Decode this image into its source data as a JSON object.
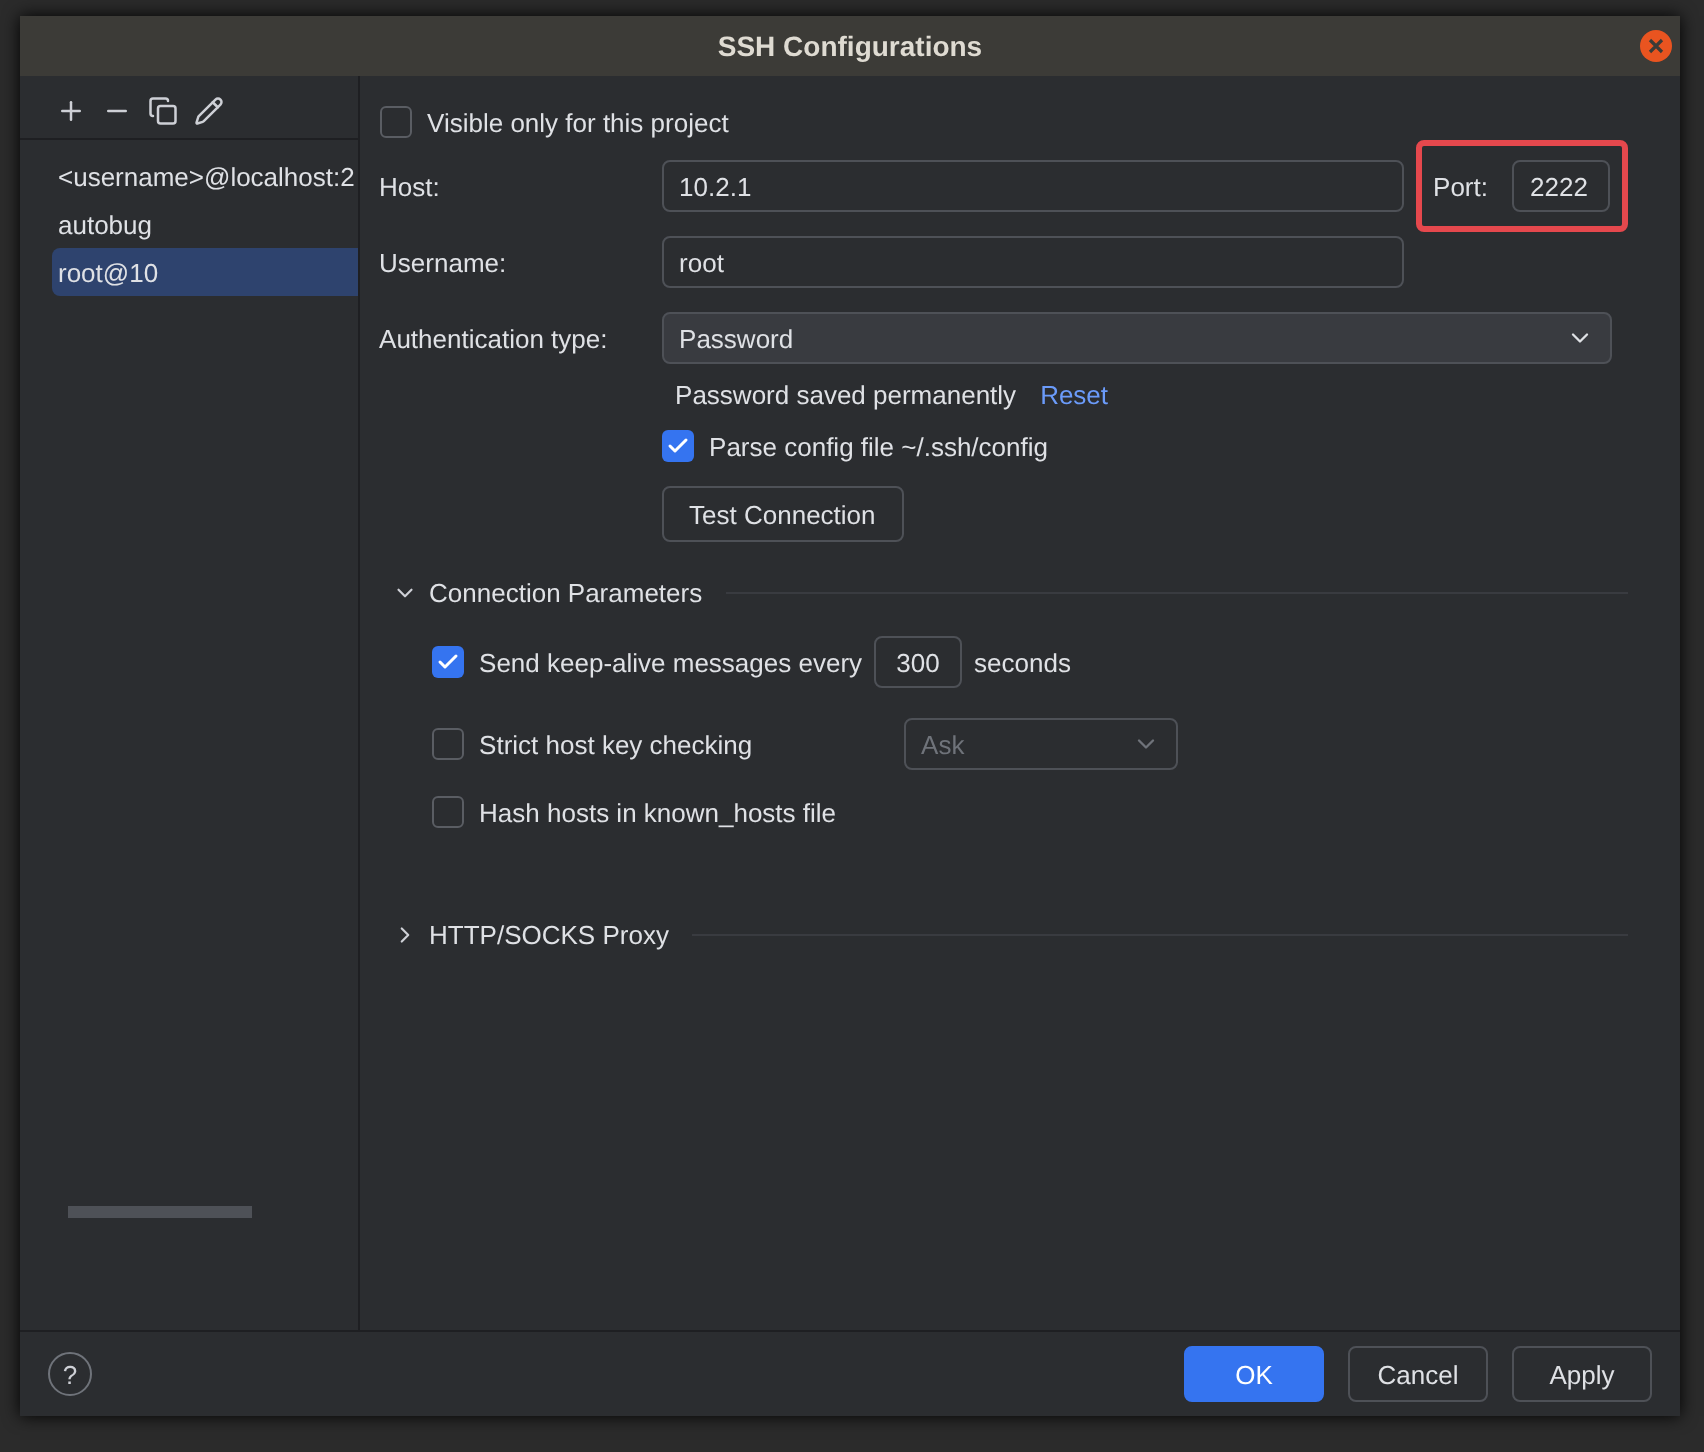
{
  "window": {
    "title": "SSH Configurations"
  },
  "configurations": [
    {
      "label": "<username>@localhost:2",
      "selected": false
    },
    {
      "label": "autobug",
      "selected": false
    },
    {
      "label": "root@10",
      "selected": true
    }
  ],
  "visible_only": {
    "label": "Visible only for this project",
    "checked": false
  },
  "host": {
    "label": "Host:",
    "value": "10.2.1"
  },
  "port": {
    "label": "Port:",
    "value": "2222",
    "highlighted": true
  },
  "username": {
    "label": "Username:",
    "value": "root"
  },
  "auth": {
    "label": "Authentication type:",
    "value": "Password"
  },
  "password_note": {
    "text": "Password saved permanently",
    "link": "Reset"
  },
  "parse_config": {
    "label": "Parse config file ~/.ssh/config",
    "checked": true
  },
  "test_button": "Test Connection",
  "connection_parameters": {
    "title": "Connection Parameters",
    "expanded": true,
    "keep_alive": {
      "label": "Send keep-alive messages every",
      "checked": true,
      "value": "300",
      "unit": "seconds"
    },
    "strict": {
      "label": "Strict host key checking",
      "checked": false,
      "value": "Ask",
      "disabled": true
    },
    "hash": {
      "label": "Hash hosts in known_hosts file",
      "checked": false
    }
  },
  "proxy": {
    "title": "HTTP/SOCKS Proxy",
    "expanded": false
  },
  "help": "?",
  "buttons": [
    {
      "label": "OK",
      "primary": true
    },
    {
      "label": "Cancel",
      "primary": false
    },
    {
      "label": "Apply",
      "primary": false
    }
  ]
}
